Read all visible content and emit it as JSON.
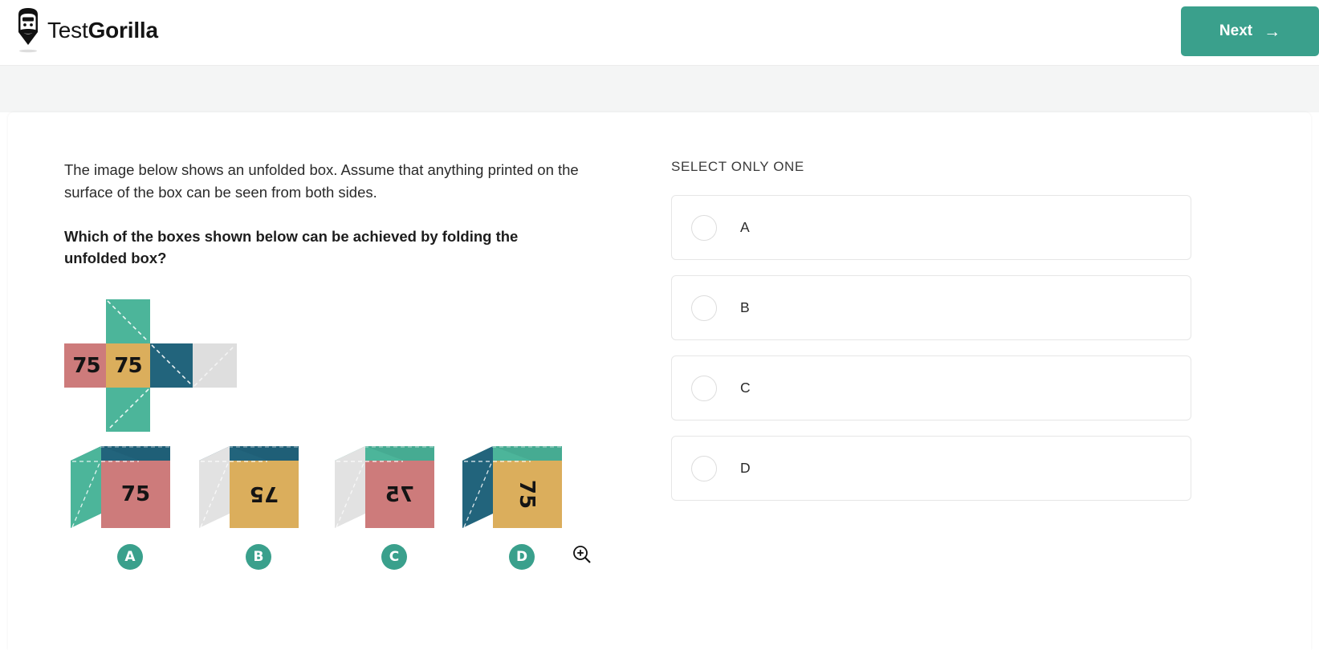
{
  "header": {
    "brand_first": "Test",
    "brand_second": "Gorilla",
    "logo_icon": "gorilla-logo-icon",
    "next_label": "Next",
    "next_arrow": "→",
    "accent_color": "#3aa08c"
  },
  "question": {
    "intro": "The image below shows an unfolded box. Assume that anything printed on the surface of the box can be seen from both sides.",
    "prompt": "Which of the boxes shown below can be achieved by folding the unfolded box?"
  },
  "net": {
    "caption": "unfolded-box-net",
    "colors": {
      "green": "#4cb59a",
      "pink": "#cd7b7b",
      "gold": "#dbae5c",
      "teal": "#22647c",
      "gray": "#dedede"
    },
    "cells": [
      {
        "name": "top-green",
        "label": ""
      },
      {
        "name": "left-pink",
        "label": "75"
      },
      {
        "name": "center-gold",
        "label": "75"
      },
      {
        "name": "right-teal",
        "label": ""
      },
      {
        "name": "far-right-gray",
        "label": ""
      },
      {
        "name": "bottom-green",
        "label": ""
      }
    ]
  },
  "boxes": [
    {
      "letter": "A",
      "front_color": "#cd7b7b",
      "top_color": "#22647c",
      "side_color": "#4cb59a",
      "front_text": "75",
      "front_text_transform": "none"
    },
    {
      "letter": "B",
      "front_color": "#dbae5c",
      "top_color": "#22647c",
      "side_color": "#dedede",
      "front_text": "75",
      "front_text_transform": "rotate-180"
    },
    {
      "letter": "C",
      "front_color": "#cd7b7b",
      "top_color": "#4cb59a",
      "side_color": "#dedede",
      "front_text": "75",
      "front_text_transform": "mirror-x"
    },
    {
      "letter": "D",
      "front_color": "#dbae5c",
      "top_color": "#4cb59a",
      "side_color": "#22647c",
      "front_text": "75",
      "front_text_transform": "rotate-90"
    }
  ],
  "zoom_tool": {
    "icon": "magnifier-plus-icon"
  },
  "answers": {
    "hint": "SELECT ONLY ONE",
    "options": [
      {
        "id": "A",
        "label": "A",
        "selected": false
      },
      {
        "id": "B",
        "label": "B",
        "selected": false
      },
      {
        "id": "C",
        "label": "C",
        "selected": false
      },
      {
        "id": "D",
        "label": "D",
        "selected": false
      }
    ]
  }
}
